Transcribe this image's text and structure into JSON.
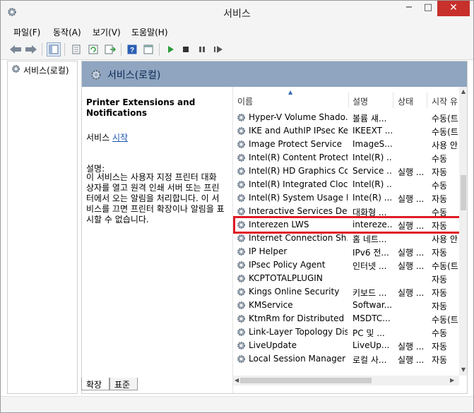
{
  "window": {
    "title": "서비스"
  },
  "titlebar": {
    "min": "−",
    "max": "□",
    "close": "✕"
  },
  "menu": [
    "파일(F)",
    "동작(A)",
    "보기(V)",
    "도움말(H)"
  ],
  "tree": {
    "item": "서비스(로컬)"
  },
  "header": {
    "title": "서비스(로컬)"
  },
  "details": {
    "service_title": "Printer Extensions and Notifications",
    "action_prefix": "서비스 ",
    "action_link": "시작",
    "desc_heading": "설명:",
    "desc_body": "이 서비스는 사용자 지정 프린터 대화 상자를 열고 원격 인쇄 서버 또는 프린터에서 오는 알림을 처리합니다. 이 서비스를 끄면 프린터 확장이나 알림을 표시할 수 없습니다."
  },
  "columns": {
    "name": "이름",
    "desc": "설명",
    "status": "상태",
    "start": "시작 유"
  },
  "services": [
    {
      "name": "Hyper-V Volume Shado...",
      "desc": "볼륨 섀...",
      "status": "",
      "start": "수동(트"
    },
    {
      "name": "IKE and AuthIP IPsec Ke...",
      "desc": "IKEEXT ...",
      "status": "",
      "start": "수동(트"
    },
    {
      "name": "Image Protect Service",
      "desc": "ImageS...",
      "status": "",
      "start": "사용 안"
    },
    {
      "name": "Intel(R) Content Protecti...",
      "desc": "Intel(R) ...",
      "status": "",
      "start": "수동"
    },
    {
      "name": "Intel(R) HD Graphics Co...",
      "desc": "Service ...",
      "status": "실행 ...",
      "start": "자동"
    },
    {
      "name": "Intel(R) Integrated Clock...",
      "desc": "Intel(R) ...",
      "status": "",
      "start": "수동"
    },
    {
      "name": "Intel(R) System Usage R...",
      "desc": "Inte(R) ...",
      "status": "실행 ...",
      "start": "자동"
    },
    {
      "name": "Interactive Services Det...",
      "desc": "대화형 ...",
      "status": "",
      "start": "수동"
    },
    {
      "name": "Interezen LWS",
      "desc": "intereze...",
      "status": "실행 ...",
      "start": "자동"
    },
    {
      "name": "Internet Connection Sh...",
      "desc": "홈 네트...",
      "status": "",
      "start": "사용 안"
    },
    {
      "name": "IP Helper",
      "desc": "IPv6 전...",
      "status": "실행 ...",
      "start": "자동"
    },
    {
      "name": "IPsec Policy Agent",
      "desc": "인터넷 ...",
      "status": "실행 ...",
      "start": "수동(트"
    },
    {
      "name": "KCPTOTALPLUGIN",
      "desc": "",
      "status": "",
      "start": "자동"
    },
    {
      "name": "Kings Online Security",
      "desc": "키보드 ...",
      "status": "실행 ...",
      "start": "자동"
    },
    {
      "name": "KMService",
      "desc": "Softwar...",
      "status": "",
      "start": "자동"
    },
    {
      "name": "KtmRm for Distributed ...",
      "desc": "MSDTC...",
      "status": "",
      "start": "수동(트"
    },
    {
      "name": "Link-Layer Topology Dis...",
      "desc": "PC 및 ...",
      "status": "",
      "start": "수동"
    },
    {
      "name": "LiveUpdate",
      "desc": "LiveUp...",
      "status": "실행 ...",
      "start": "자동"
    },
    {
      "name": "Local Session Manager",
      "desc": "로컬 사...",
      "status": "실행 ...",
      "start": "자동"
    }
  ],
  "tabs": {
    "extended": "확장",
    "standard": "표준"
  },
  "colors": {
    "header_bg": "#8fa5c0",
    "highlight": "#e01b24",
    "close_bg": "#c7302b",
    "link": "#1c56b2"
  }
}
